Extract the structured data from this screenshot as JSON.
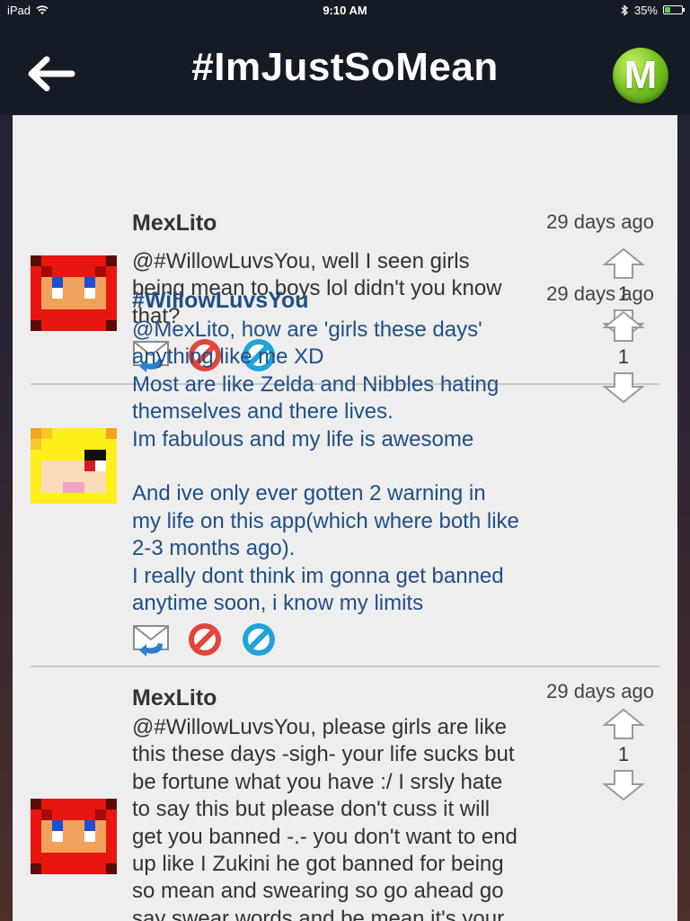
{
  "status_bar": {
    "device": "iPad",
    "time": "9:10 AM",
    "battery": "35%",
    "battery_level": 0.35
  },
  "header": {
    "title": "#ImJustSoMean",
    "logo_letter": "M"
  },
  "colors": {
    "nav_bg": "#141b24",
    "username_blue": "#1f4f86",
    "logo_green": "#7cc623",
    "block_red": "#e2453a",
    "action_blue": "#1fa3d8"
  },
  "posts": [
    {
      "username": "MexLito",
      "timestamp": "29 days ago",
      "body": "@#WillowLuvsYou, well I seen girls\nbeing mean to boys lol didn't you know\nthat?",
      "votes": "1",
      "avatar": "red-pixel-avatar"
    },
    {
      "username": "#WillowLuvsYou",
      "timestamp": "29 days ago",
      "body": "@MexLito, how are 'girls these days'\nanything like me XD\nMost are like Zelda and Nibbles hating\nthemselves and there lives.\nIm fabulous and my life is awesome\n\nAnd ive only ever gotten 2 warning in\nmy life on this app(which where both like\n2-3 months ago).\nI really dont think im gonna get banned\nanytime soon, i know my limits",
      "votes": "1",
      "avatar": "blonde-pixel-avatar"
    },
    {
      "username": "MexLito",
      "timestamp": "29 days ago",
      "body": "@#WillowLuvsYou, please girls are like\nthis these days -sigh- your life sucks but\nbe fortune what you have :/ I srsly hate\nto say this but please don't cuss it will\nget you banned -.- you don't want to end\nup like I Zukini he got banned for being\nso mean and swearing so go ahead go\nsay swear words and be mean it's your",
      "votes": "1",
      "avatar": "red-pixel-avatar"
    }
  ]
}
